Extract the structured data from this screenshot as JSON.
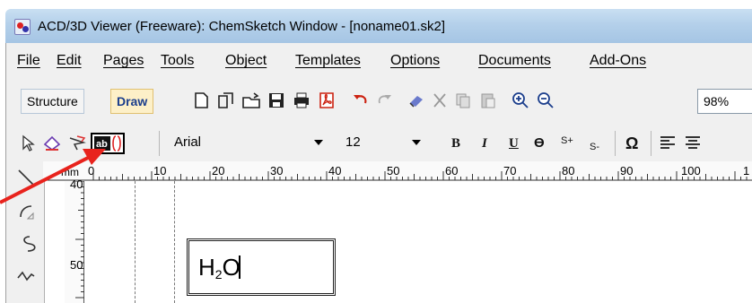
{
  "window": {
    "title": "ACD/3D Viewer (Freeware): ChemSketch Window - [noname01.sk2]",
    "icon": "chemsketch-app-icon"
  },
  "menu": {
    "items": [
      "File",
      "Edit",
      "Pages",
      "Tools",
      "Object",
      "Templates",
      "Options",
      "Documents",
      "Add-Ons"
    ]
  },
  "toolbar": {
    "structure_label": "Structure",
    "draw_label": "Draw",
    "zoom": "98%"
  },
  "text_toolbar": {
    "font": "Arial",
    "size": "12",
    "bold": "B",
    "italic": "I",
    "underline": "U",
    "strike": "Ө",
    "superscript": "S+",
    "subscript": "S-",
    "symbol": "Ω"
  },
  "ruler": {
    "unit": "mm",
    "h_ticks": [
      "0",
      "10",
      "20",
      "30",
      "40",
      "50",
      "60",
      "70",
      "80",
      "90",
      "100",
      "1"
    ],
    "v_ticks": [
      "40",
      "50"
    ]
  },
  "canvas": {
    "formula_main": "H",
    "formula_sub": "2",
    "formula_tail": "O"
  },
  "annotation": {
    "arrow_color": "#e8231d"
  }
}
